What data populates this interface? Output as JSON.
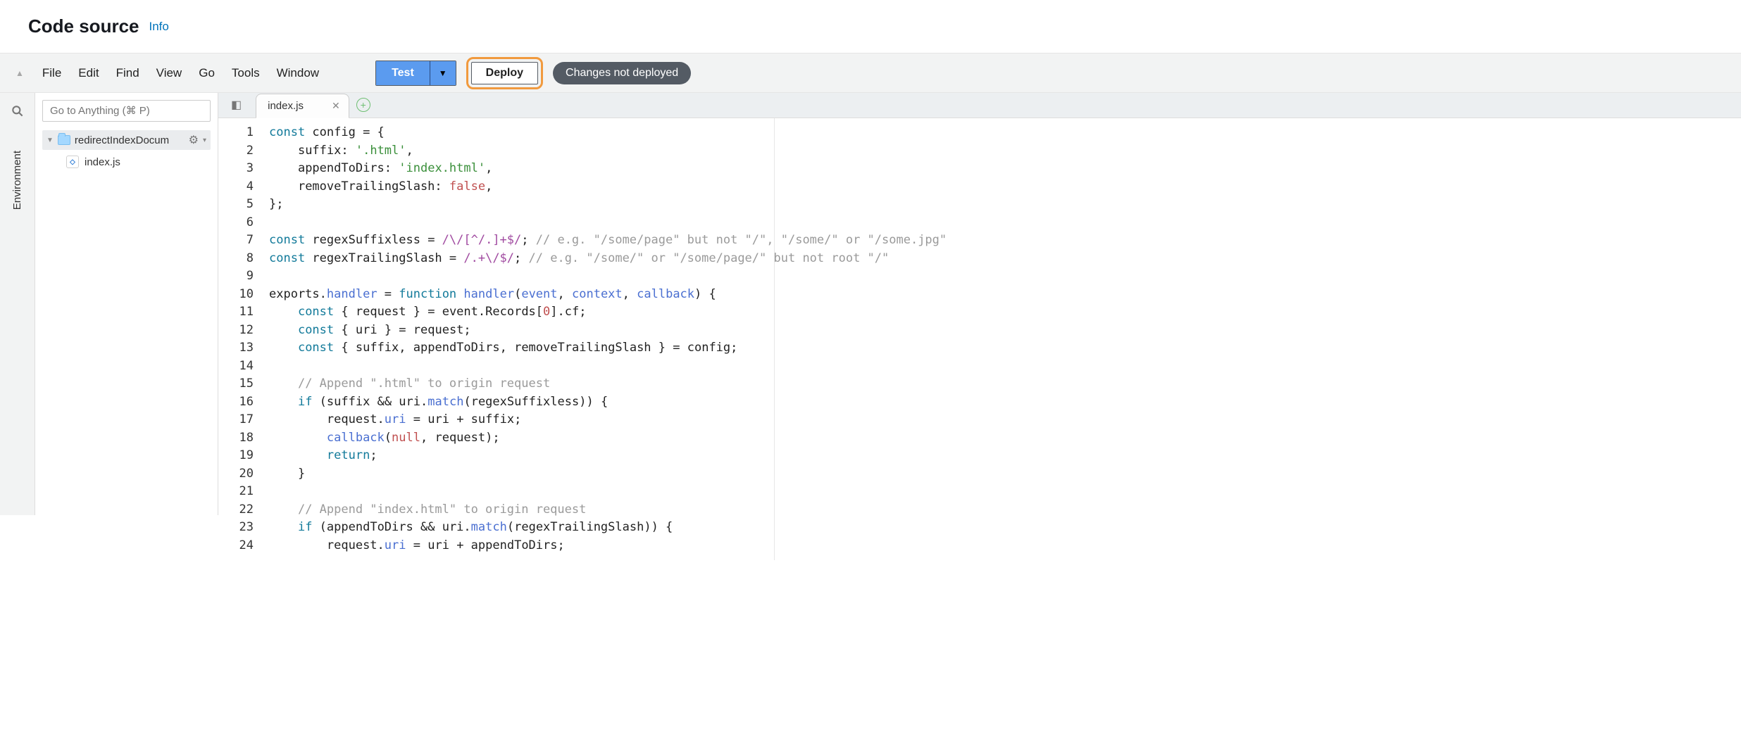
{
  "header": {
    "title": "Code source",
    "info_label": "Info"
  },
  "toolbar": {
    "menu": [
      "File",
      "Edit",
      "Find",
      "View",
      "Go",
      "Tools",
      "Window"
    ],
    "test_label": "Test",
    "deploy_label": "Deploy",
    "status_label": "Changes not deployed"
  },
  "explorer": {
    "goto_placeholder": "Go to Anything (⌘ P)",
    "side_rail_label": "Environment",
    "project_name": "redirectIndexDocum",
    "files": [
      "index.js"
    ]
  },
  "editor": {
    "active_tab": "index.js",
    "lines": [
      [
        {
          "t": "kw",
          "v": "const"
        },
        {
          "t": "p",
          "v": " config "
        },
        {
          "t": "op",
          "v": "= {"
        }
      ],
      [
        {
          "t": "ind",
          "v": "    "
        },
        {
          "t": "p",
          "v": "suffix"
        },
        {
          "t": "op",
          "v": ": "
        },
        {
          "t": "str",
          "v": "'.html'"
        },
        {
          "t": "op",
          "v": ","
        }
      ],
      [
        {
          "t": "ind",
          "v": "    "
        },
        {
          "t": "p",
          "v": "appendToDirs"
        },
        {
          "t": "op",
          "v": ": "
        },
        {
          "t": "str",
          "v": "'index.html'"
        },
        {
          "t": "op",
          "v": ","
        }
      ],
      [
        {
          "t": "ind",
          "v": "    "
        },
        {
          "t": "p",
          "v": "removeTrailingSlash"
        },
        {
          "t": "op",
          "v": ": "
        },
        {
          "t": "bool",
          "v": "false"
        },
        {
          "t": "op",
          "v": ","
        }
      ],
      [
        {
          "t": "op",
          "v": "};"
        }
      ],
      [],
      [
        {
          "t": "kw",
          "v": "const"
        },
        {
          "t": "p",
          "v": " regexSuffixless "
        },
        {
          "t": "op",
          "v": "= "
        },
        {
          "t": "regex",
          "v": "/\\/[^/.]+$/"
        },
        {
          "t": "op",
          "v": "; "
        },
        {
          "t": "cmt",
          "v": "// e.g. \"/some/page\" but not \"/\", \"/some/\" or \"/some.jpg\""
        }
      ],
      [
        {
          "t": "kw",
          "v": "const"
        },
        {
          "t": "p",
          "v": " regexTrailingSlash "
        },
        {
          "t": "op",
          "v": "= "
        },
        {
          "t": "regex",
          "v": "/.+\\/$/"
        },
        {
          "t": "op",
          "v": "; "
        },
        {
          "t": "cmt",
          "v": "// e.g. \"/some/\" or \"/some/page/\" but not root \"/\""
        }
      ],
      [],
      [
        {
          "t": "p",
          "v": "exports"
        },
        {
          "t": "op",
          "v": "."
        },
        {
          "t": "id",
          "v": "handler"
        },
        {
          "t": "op",
          "v": " = "
        },
        {
          "t": "kw",
          "v": "function"
        },
        {
          "t": "p",
          "v": " "
        },
        {
          "t": "fn",
          "v": "handler"
        },
        {
          "t": "op",
          "v": "("
        },
        {
          "t": "id",
          "v": "event"
        },
        {
          "t": "op",
          "v": ", "
        },
        {
          "t": "id",
          "v": "context"
        },
        {
          "t": "op",
          "v": ", "
        },
        {
          "t": "id",
          "v": "callback"
        },
        {
          "t": "op",
          "v": ") {"
        }
      ],
      [
        {
          "t": "ind",
          "v": "    "
        },
        {
          "t": "kw",
          "v": "const"
        },
        {
          "t": "op",
          "v": " { "
        },
        {
          "t": "p",
          "v": "request"
        },
        {
          "t": "op",
          "v": " } = "
        },
        {
          "t": "p",
          "v": "event"
        },
        {
          "t": "op",
          "v": "."
        },
        {
          "t": "p",
          "v": "Records"
        },
        {
          "t": "op",
          "v": "["
        },
        {
          "t": "num",
          "v": "0"
        },
        {
          "t": "op",
          "v": "]."
        },
        {
          "t": "p",
          "v": "cf"
        },
        {
          "t": "op",
          "v": ";"
        }
      ],
      [
        {
          "t": "ind",
          "v": "    "
        },
        {
          "t": "kw",
          "v": "const"
        },
        {
          "t": "op",
          "v": " { "
        },
        {
          "t": "p",
          "v": "uri"
        },
        {
          "t": "op",
          "v": " } = "
        },
        {
          "t": "p",
          "v": "request"
        },
        {
          "t": "op",
          "v": ";"
        }
      ],
      [
        {
          "t": "ind",
          "v": "    "
        },
        {
          "t": "kw",
          "v": "const"
        },
        {
          "t": "op",
          "v": " { "
        },
        {
          "t": "p",
          "v": "suffix"
        },
        {
          "t": "op",
          "v": ", "
        },
        {
          "t": "p",
          "v": "appendToDirs"
        },
        {
          "t": "op",
          "v": ", "
        },
        {
          "t": "p",
          "v": "removeTrailingSlash"
        },
        {
          "t": "op",
          "v": " } = "
        },
        {
          "t": "p",
          "v": "config"
        },
        {
          "t": "op",
          "v": ";"
        }
      ],
      [],
      [
        {
          "t": "ind",
          "v": "    "
        },
        {
          "t": "cmt",
          "v": "// Append \".html\" to origin request"
        }
      ],
      [
        {
          "t": "ind",
          "v": "    "
        },
        {
          "t": "kw",
          "v": "if"
        },
        {
          "t": "op",
          "v": " ("
        },
        {
          "t": "p",
          "v": "suffix"
        },
        {
          "t": "op",
          "v": " && "
        },
        {
          "t": "p",
          "v": "uri"
        },
        {
          "t": "op",
          "v": "."
        },
        {
          "t": "fn",
          "v": "match"
        },
        {
          "t": "op",
          "v": "("
        },
        {
          "t": "p",
          "v": "regexSuffixless"
        },
        {
          "t": "op",
          "v": ")) {"
        }
      ],
      [
        {
          "t": "ind",
          "v": "        "
        },
        {
          "t": "p",
          "v": "request"
        },
        {
          "t": "op",
          "v": "."
        },
        {
          "t": "id",
          "v": "uri"
        },
        {
          "t": "op",
          "v": " = "
        },
        {
          "t": "p",
          "v": "uri"
        },
        {
          "t": "op",
          "v": " + "
        },
        {
          "t": "p",
          "v": "suffix"
        },
        {
          "t": "op",
          "v": ";"
        }
      ],
      [
        {
          "t": "ind",
          "v": "        "
        },
        {
          "t": "fn",
          "v": "callback"
        },
        {
          "t": "op",
          "v": "("
        },
        {
          "t": "bool",
          "v": "null"
        },
        {
          "t": "op",
          "v": ", "
        },
        {
          "t": "p",
          "v": "request"
        },
        {
          "t": "op",
          "v": ");"
        }
      ],
      [
        {
          "t": "ind",
          "v": "        "
        },
        {
          "t": "kw",
          "v": "return"
        },
        {
          "t": "op",
          "v": ";"
        }
      ],
      [
        {
          "t": "ind",
          "v": "    "
        },
        {
          "t": "op",
          "v": "}"
        }
      ],
      [],
      [
        {
          "t": "ind",
          "v": "    "
        },
        {
          "t": "cmt",
          "v": "// Append \"index.html\" to origin request"
        }
      ],
      [
        {
          "t": "ind",
          "v": "    "
        },
        {
          "t": "kw",
          "v": "if"
        },
        {
          "t": "op",
          "v": " ("
        },
        {
          "t": "p",
          "v": "appendToDirs"
        },
        {
          "t": "op",
          "v": " && "
        },
        {
          "t": "p",
          "v": "uri"
        },
        {
          "t": "op",
          "v": "."
        },
        {
          "t": "fn",
          "v": "match"
        },
        {
          "t": "op",
          "v": "("
        },
        {
          "t": "p",
          "v": "regexTrailingSlash"
        },
        {
          "t": "op",
          "v": ")) {"
        }
      ],
      [
        {
          "t": "ind",
          "v": "        "
        },
        {
          "t": "p",
          "v": "request"
        },
        {
          "t": "op",
          "v": "."
        },
        {
          "t": "id",
          "v": "uri"
        },
        {
          "t": "op",
          "v": " = "
        },
        {
          "t": "p",
          "v": "uri"
        },
        {
          "t": "op",
          "v": " + "
        },
        {
          "t": "p",
          "v": "appendToDirs"
        },
        {
          "t": "op",
          "v": ";"
        }
      ]
    ]
  }
}
